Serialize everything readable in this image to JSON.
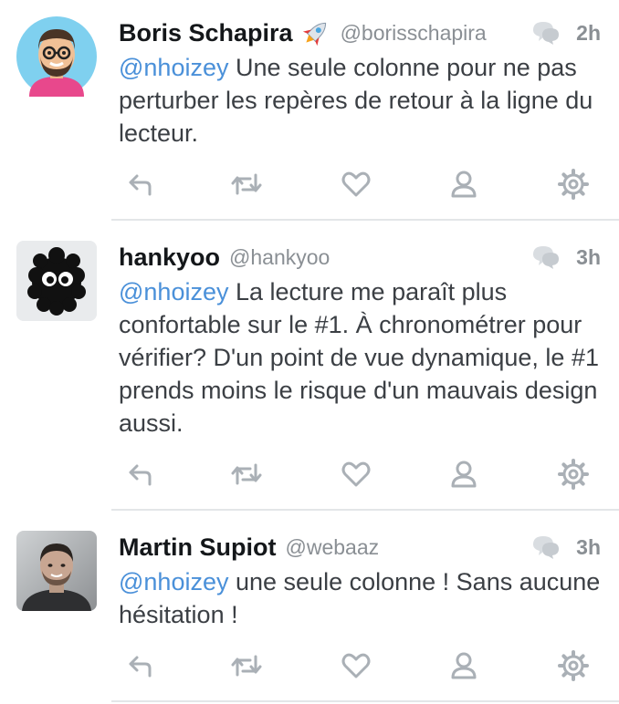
{
  "tweets": [
    {
      "name": "Boris Schapira",
      "emoji": "rocket-emoji",
      "handle": "@borisschapira",
      "time": "2h",
      "mention": "@nhoizey",
      "text": " Une seule colonne pour ne pas perturber les repères de retour à la ligne du lecteur."
    },
    {
      "name": "hankyoo",
      "handle": "@hankyoo",
      "time": "3h",
      "mention": "@nhoizey",
      "text": " La lecture me paraît plus confortable sur le #1. À chronométrer pour vérifier? D'un point de vue dynamique, le #1 prends moins le risque d'un mauvais design aussi."
    },
    {
      "name": "Martin Supiot",
      "handle": "@webaaz",
      "time": "3h",
      "mention": "@nhoizey",
      "text": " une seule colonne ! Sans aucune hésitation !"
    }
  ],
  "icons": {
    "conversation": "conversation-icon",
    "reply": "reply-icon",
    "retweet": "retweet-icon",
    "like": "heart-icon",
    "profile": "user-icon",
    "more": "gear-icon"
  },
  "colors": {
    "mention": "#4a90d9",
    "meta": "#8a8f94",
    "icon": "#aab0b6",
    "divider": "#e3e6e8"
  }
}
